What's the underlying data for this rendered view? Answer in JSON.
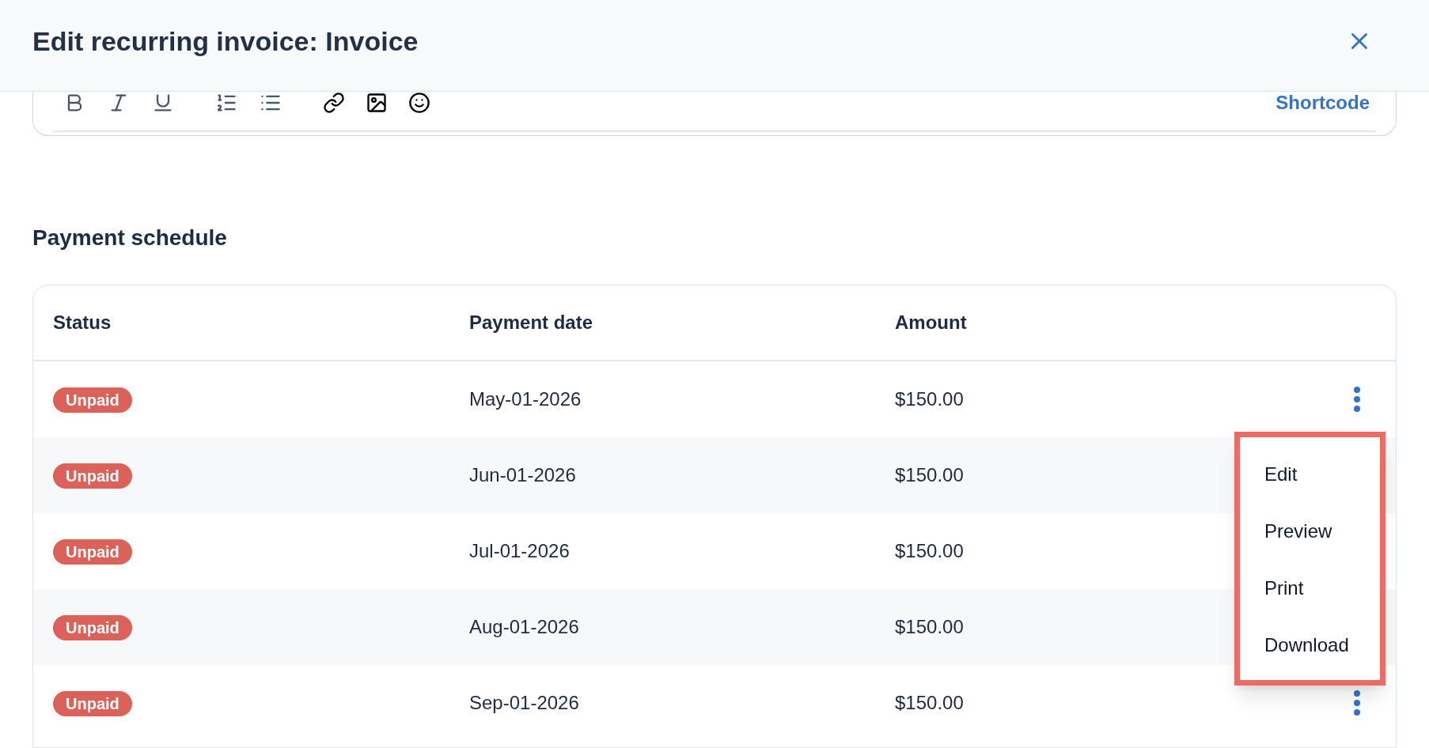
{
  "dialog": {
    "title": "Edit recurring invoice: Invoice"
  },
  "editor_toolbar": {
    "shortcode_link": "Shortcode"
  },
  "payment_schedule": {
    "heading": "Payment schedule",
    "columns": [
      "Status",
      "Payment date",
      "Amount"
    ],
    "rows": [
      {
        "status": "Unpaid",
        "payment_date": "May-01-2026",
        "amount": "$150.00"
      },
      {
        "status": "Unpaid",
        "payment_date": "Jun-01-2026",
        "amount": "$150.00"
      },
      {
        "status": "Unpaid",
        "payment_date": "Jul-01-2026",
        "amount": "$150.00"
      },
      {
        "status": "Unpaid",
        "payment_date": "Aug-01-2026",
        "amount": "$150.00"
      },
      {
        "status": "Unpaid",
        "payment_date": "Sep-01-2026",
        "amount": "$150.00"
      }
    ]
  },
  "actions_menu": {
    "items": [
      "Edit",
      "Preview",
      "Print",
      "Download"
    ]
  }
}
